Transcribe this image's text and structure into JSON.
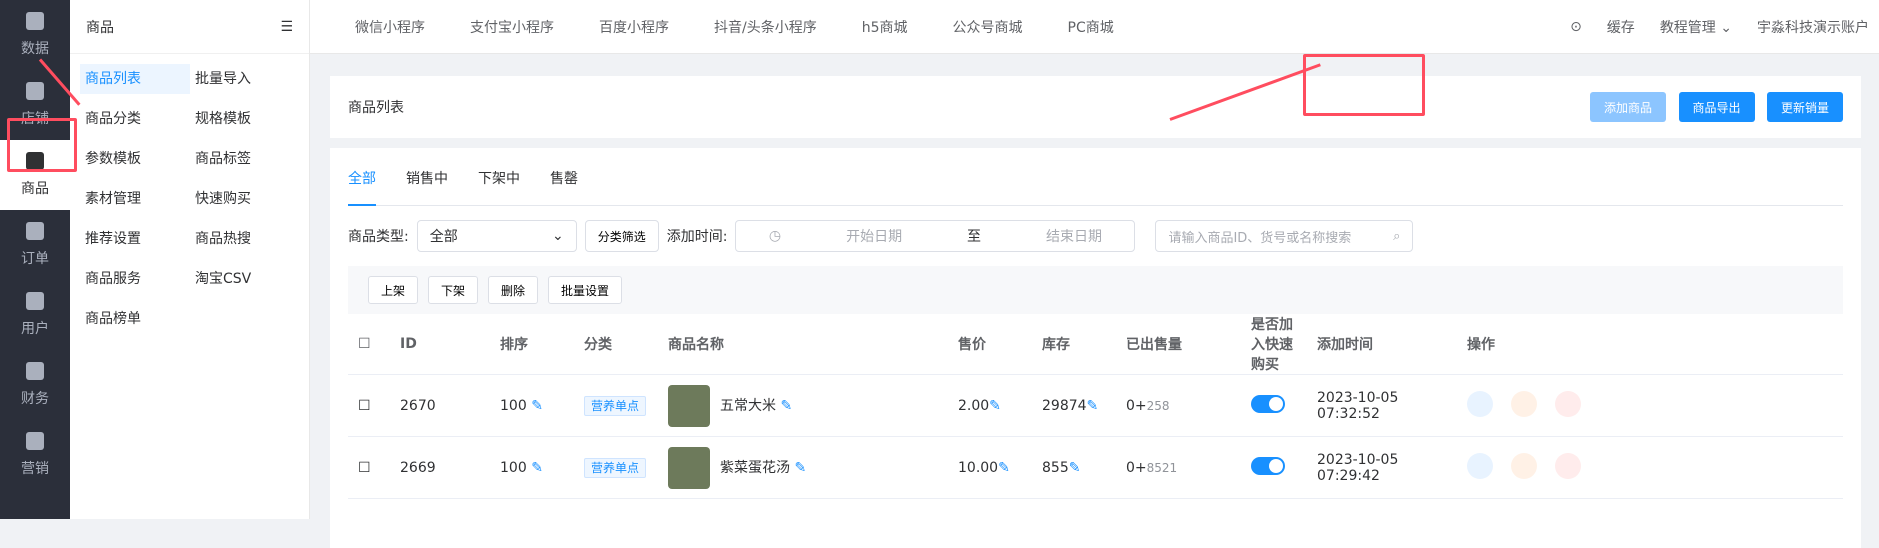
{
  "leftnav": {
    "items": [
      "数据",
      "店铺",
      "商品",
      "订单",
      "用户",
      "财务",
      "营销"
    ]
  },
  "subnav": {
    "title": "商品",
    "items": [
      "商品列表",
      "批量导入",
      "商品分类",
      "规格模板",
      "参数模板",
      "商品标签",
      "素材管理",
      "快速购买",
      "推荐设置",
      "商品热搜",
      "商品服务",
      "淘宝CSV",
      "商品榜单"
    ]
  },
  "topbar": {
    "tabs": [
      "微信小程序",
      "支付宝小程序",
      "百度小程序",
      "抖音/头条小程序",
      "h5商城",
      "公众号商城",
      "PC商城"
    ],
    "cache": "缓存",
    "tutorial": "教程管理",
    "account": "宇淼科技演示账户"
  },
  "page": {
    "title": "商品列表",
    "add_btn": "添加商品",
    "export_btn": "商品导出",
    "update_btn": "更新销量"
  },
  "tabs": [
    "全部",
    "销售中",
    "下架中",
    "售罄"
  ],
  "filters": {
    "type_label": "商品类型:",
    "type_value": "全部",
    "filter_btn": "分类筛选",
    "time_label": "添加时间:",
    "start": "开始日期",
    "to": "至",
    "end": "结束日期",
    "search_placeholder": "请输入商品ID、货号或名称搜索"
  },
  "actions": [
    "上架",
    "下架",
    "删除",
    "批量设置"
  ],
  "table": {
    "headers": [
      "ID",
      "排序",
      "分类",
      "商品名称",
      "售价",
      "库存",
      "已出售量",
      "是否加入快速购买",
      "添加时间",
      "操作"
    ],
    "rows": [
      {
        "id": "2670",
        "sort": "100",
        "category": "营养单点",
        "name": "五常大米",
        "price": "2.00",
        "stock": "29874",
        "sold": "0+",
        "sold_extra": "258",
        "time": "2023-10-05 07:32:52"
      },
      {
        "id": "2669",
        "sort": "100",
        "category": "营养单点",
        "name": "紫菜蛋花汤",
        "price": "10.00",
        "stock": "855",
        "sold": "0+",
        "sold_extra": "8521",
        "time": "2023-10-05 07:29:42"
      }
    ]
  }
}
